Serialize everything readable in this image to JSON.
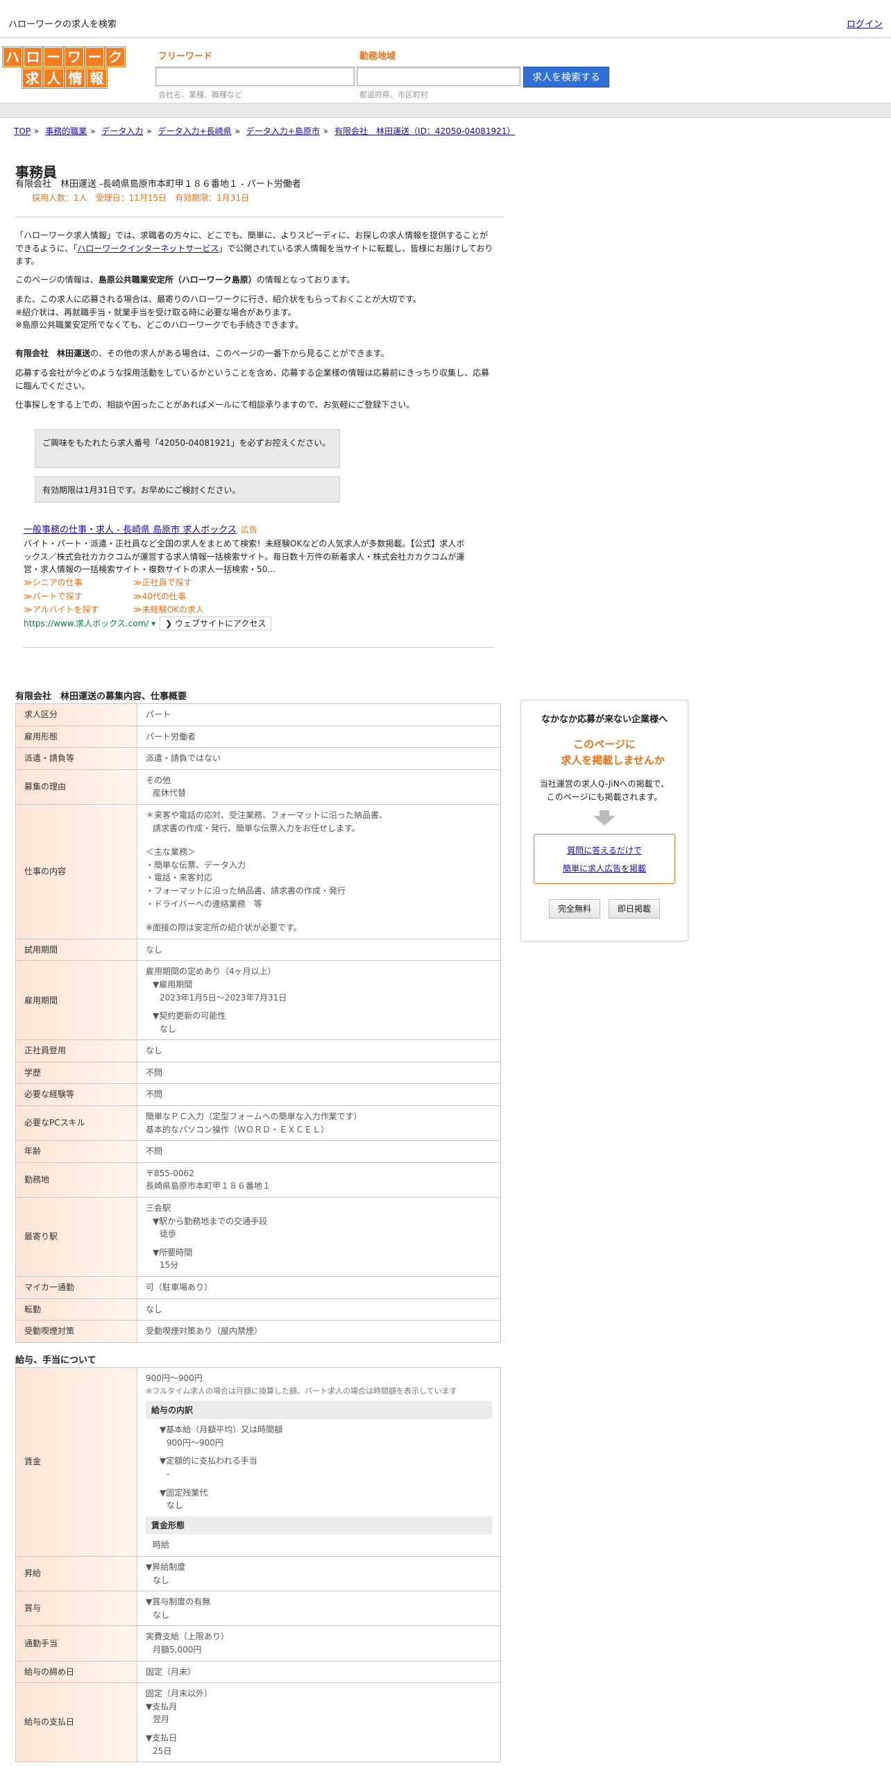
{
  "topbar": {
    "title": "ハローワークの求人を検索",
    "login": "ログイン"
  },
  "logo": {
    "row1": [
      "ハ",
      "ロ",
      "ー",
      "ワ",
      "ー",
      "ク"
    ],
    "row2": [
      "求",
      "人",
      "情",
      "報"
    ]
  },
  "search": {
    "keyword_label": "フリーワード",
    "keyword_placeholder": "会社名、業種、職種など",
    "area_label": "勤務地域",
    "area_placeholder": "都道府県、市区町村",
    "button": "求人を検索する"
  },
  "breadcrumb": [
    "TOP",
    "事務的職業",
    "データ入力",
    "データ入力+長崎県",
    "データ入力+島原市",
    "有限会社　林田運送（ID：42050-04081921）"
  ],
  "job": {
    "title": "事務員",
    "company_line": "有限会社　林田運送 -長崎県島原市本町甲１８６番地１ - パート労働者",
    "meta": "採用人数：1人　受理日：11月15日　有効期限：1月31日"
  },
  "intro": {
    "p1_a": "「ハローワーク求人情報」では、求職者の方々に、どこでも、簡単に、よりスピーディに、お探しの求人情報を提供することができるように、「",
    "p1_link": "ハローワークインターネットサービス",
    "p1_b": "」で公開されている求人情報を当サイトに転載し、皆様にお届けしております。",
    "p2_a": "このページの情報は、",
    "p2_bold": "島原公共職業安定所（ハローワーク島原）",
    "p2_b": "の情報となっております。",
    "p3_1": "また、この求人に応募される場合は、最寄りのハローワークに行き、紹介状をもらっておくことが大切です。",
    "p3_2": "※紹介状は、再就職手当・就業手当を受け取る時に必要な場合があります。",
    "p3_3": "※島原公共職業安定所でなくても、どこのハローワークでも手続きできます。",
    "p4_bold": "有限会社　林田運送",
    "p4_b": "の、その他の求人がある場合は、このページの一番下から見ることができます。",
    "p5": "応募する会社が今どのような採用活動をしているかということを含め、応募する企業様の情報は応募前にきっちり収集し、応募に臨んでください。",
    "p6": "仕事探しをする上での、相談や困ったことがあればメールにて相談承りますので、お気軽にご登録下さい。"
  },
  "notices": {
    "n1": "ご興味をもたれたら求人番号「42050-04081921」を必ずお控えください。",
    "n2": "有効期限は1月31日です。お早めにご検討ください。"
  },
  "ad": {
    "title": "一般事務の仕事・求人 - 長崎県 島原市 求人ボックス",
    "tag": "広告",
    "desc": "バイト・パート・派遣・正社員など全国の求人をまとめて検索！未経験OKなどの人気求人が多数掲載。【公式】求人ボックス／株式会社カカクコムが運営する求人情報一括検索サイト。毎日数十万件の新着求人・株式会社カカクコムが運営・求人情報の一括検索サイト・複数サイトの求人一括検索・50...",
    "links": [
      "≫シニアの仕事",
      "≫正社員で探す",
      "≫パートで探す",
      "≫40代の仕事",
      "≫アルバイトを探す",
      "≫未経験OKの求人"
    ],
    "url": "https://www.求人ボックス.com/",
    "visit": "❯ ウェブサイトにアクセス"
  },
  "section1": {
    "title": "有限会社　林田運送の募集内容、仕事概要",
    "rows": {
      "kyujin_kubun": {
        "k": "求人区分",
        "v": "パート"
      },
      "koyo_keitai": {
        "k": "雇用形態",
        "v": "パート労働者"
      },
      "haken": {
        "k": "派遣・請負等",
        "v": "派遣・請負ではない"
      },
      "riyu": {
        "k": "募集の理由",
        "v1": "その他",
        "v2": "産休代替"
      },
      "shigoto": {
        "k": "仕事の内容",
        "l1": "＊来客や電話の応対、受注業務、フォーマットに沿った納品書、",
        "l2": "請求書の作成・発行、簡単な伝票入力をお任せします。",
        "l3": "＜主な業務＞",
        "l4": "・簡単な伝票、データ入力",
        "l5": "・電話・来客対応",
        "l6": "・フォーマットに沿った納品書、請求書の作成・発行",
        "l7": "・ドライバーへの連絡業務　等",
        "l8": "※面接の際は安定所の紹介状が必要です。"
      },
      "shiyo": {
        "k": "試用期間",
        "v": "なし"
      },
      "koyo_kikan": {
        "k": "雇用期間",
        "v1": "雇用期間の定めあり（4ヶ月以上）",
        "v2": "▼雇用期間",
        "v3": "2023年1月5日〜2023年7月31日",
        "v4": "▼契約更新の可能性",
        "v5": "なし"
      },
      "seishain": {
        "k": "正社員登用",
        "v": "なし"
      },
      "gakureki": {
        "k": "学歴",
        "v": "不問"
      },
      "keiken": {
        "k": "必要な経験等",
        "v": "不問"
      },
      "pc": {
        "k": "必要なPCスキル",
        "v1": "簡単なＰＣ入力（定型フォームへの簡単な入力作業です）",
        "v2": "基本的なパソコン操作（ＷＯＲＤ・ＥＸＣＥＬ）"
      },
      "nenrei": {
        "k": "年齢",
        "v": "不問"
      },
      "kinmuchi": {
        "k": "勤務地",
        "v1": "〒855-0062",
        "v2": "長崎県島原市本町甲１８６番地１"
      },
      "moyori": {
        "k": "最寄り駅",
        "v1": "三会駅",
        "v2": "▼駅から勤務地までの交通手段",
        "v3": "徒歩",
        "v4": "▼所要時間",
        "v5": "15分"
      },
      "mycar": {
        "k": "マイカー通勤",
        "v": "可（駐車場あり）"
      },
      "tenkin": {
        "k": "転勤",
        "v": "なし"
      },
      "kitsuen": {
        "k": "受動喫煙対策",
        "v": "受動喫煙対策あり（屋内禁煙）"
      }
    }
  },
  "section2": {
    "title": "給与、手当について",
    "chingin": {
      "k": "賃金",
      "v1": "900円〜900円",
      "note": "※フルタイム求人の場合は月額に換算した額、パート求人の場合は時間額を表示しています",
      "sub1": "給与の内訳",
      "a1": "▼基本給（月額平均）又は時間額",
      "a2": "900円〜900円",
      "a3": "▼定額的に支払われる手当",
      "a4": "-",
      "a5": "▼固定残業代",
      "a6": "なし",
      "sub2": "賃金形態",
      "b1": "時給"
    },
    "shokyu": {
      "k": "昇給",
      "v1": "▼昇給制度",
      "v2": "なし"
    },
    "shoyo": {
      "k": "賞与",
      "v1": "▼賞与制度の有無",
      "v2": "なし"
    },
    "tsukin": {
      "k": "通勤手当",
      "v1": "実費支給（上限あり）",
      "v2": "月額5,000円"
    },
    "shimebi": {
      "k": "給与の締め日",
      "v": "固定（月末）"
    },
    "shiharai": {
      "k": "給与の支払日",
      "v1": "固定（月末以外）",
      "v2": "▼支払月",
      "v3": "翌月",
      "v4": "▼支払日",
      "v5": "25日"
    }
  },
  "sidebar": {
    "heading": "なかなか応募が来ない企業様へ",
    "orange1": "このページに",
    "orange2": "求人を掲載しませんか",
    "desc1": "当社運営の求人Q-JiNへの掲載で、",
    "desc2": "このページにも掲載されます。",
    "link1": "質問に答えるだけで",
    "link2": "簡単に求人広告を掲載",
    "btn1": "完全無料",
    "btn2": "即日掲載"
  }
}
